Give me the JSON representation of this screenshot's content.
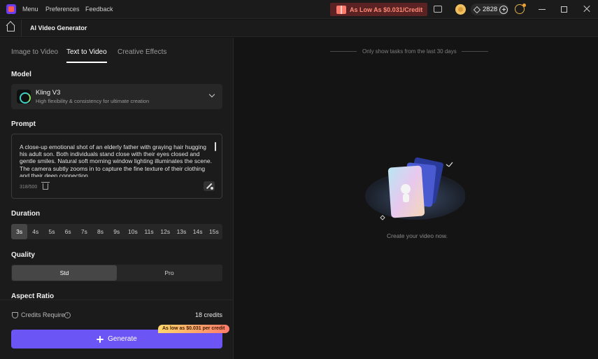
{
  "titlebar": {
    "menu": [
      "Menu",
      "Preferences",
      "Feedback"
    ],
    "promo": "As Low As $0.031/Credit",
    "credits_balance": "2828"
  },
  "header": {
    "title": "AI Video Generator"
  },
  "tabs": [
    {
      "label": "Image to Video",
      "active": false
    },
    {
      "label": "Text to Video",
      "active": true
    },
    {
      "label": "Creative Effects",
      "active": false
    }
  ],
  "model": {
    "section_label": "Model",
    "name": "Kling V3",
    "description": "High flexibility & consistency for ultimate creation"
  },
  "prompt": {
    "section_label": "Prompt",
    "text": "A close-up emotional shot of an elderly father with graying hair hugging his adult son. Both individuals stand close with their eyes closed and gentle smiles. Natural soft morning window lighting illuminates the scene. The camera subtly zooms in to capture the fine texture of their clothing and their deep connection.",
    "char_count": "318/500"
  },
  "duration": {
    "section_label": "Duration",
    "options": [
      "3s",
      "4s",
      "5s",
      "6s",
      "7s",
      "8s",
      "9s",
      "10s",
      "11s",
      "12s",
      "13s",
      "14s",
      "15s"
    ],
    "selected": "3s"
  },
  "quality": {
    "section_label": "Quality",
    "options": [
      "Std",
      "Pro"
    ],
    "selected": "Std"
  },
  "aspect_ratio": {
    "section_label": "Aspect Ratio"
  },
  "footer": {
    "credits_label": "Credits Require",
    "credits_value": "18 credits",
    "generate_label": "Generate",
    "badge": "As low as $0.031 per credit"
  },
  "right": {
    "hint": "Only show tasks from the last 30 days",
    "empty_text": "Create your video now."
  }
}
